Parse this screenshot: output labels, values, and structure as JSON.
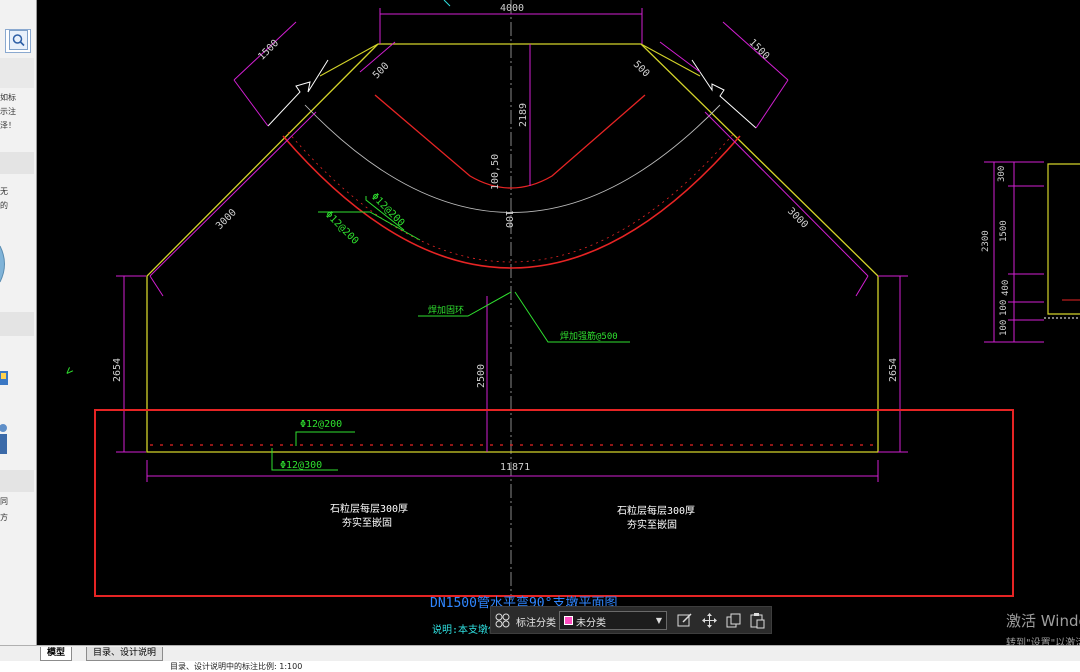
{
  "sidepanel": {
    "snippets": [
      "如标",
      "示注",
      "泽！",
      "无",
      "的",
      "同",
      "方"
    ]
  },
  "drawing": {
    "dims": {
      "top_width": "4000",
      "upper_left_1500": "1500",
      "upper_right_1500": "1500",
      "left_500": "500",
      "right_500": "500",
      "center_2189": "2189",
      "center_100_50": "100,50",
      "center_100": "100",
      "left_3000": "3000",
      "right_3000": "3000",
      "left_2654": "2654",
      "right_2654": "2654",
      "mid_2500": "2500",
      "total_11871": "11871"
    },
    "labels": {
      "rebar_1": "Φ12@200",
      "rebar_2": "Φ12@200",
      "weld_ring": "焊加固环",
      "weld_bar": "焊加强筋@500",
      "bottom_rebar_1": "Φ12@200",
      "bottom_rebar_2": "Φ12@300",
      "gravel_left_1": "石粒层每层300厚",
      "gravel_left_2": "夯实至嵌固",
      "gravel_right_1": "石粒层每层300厚",
      "gravel_right_2": "夯实至嵌固",
      "title": "DN1500管水平弯90°支墩平面图",
      "note": "说明:本支墩仅适用于..."
    },
    "side_dims": {
      "d300": "300",
      "d2300": "2300",
      "d1500": "1500",
      "d400": "400",
      "d100": "100",
      "d100b": "100"
    }
  },
  "annotation_toolbar": {
    "label": "标注分类",
    "selected": "未分类",
    "swatch_color": "#ff4fc0"
  },
  "tabs": [
    {
      "label": "模型",
      "active": true
    },
    {
      "label": "目录、设计说明",
      "active": false
    }
  ],
  "status": {
    "text": "目录、设计说明中的标注比例: 1:100"
  },
  "watermark": {
    "line1": "激活 Windows",
    "line2": "转到\"设置\"以激活Windows。"
  }
}
